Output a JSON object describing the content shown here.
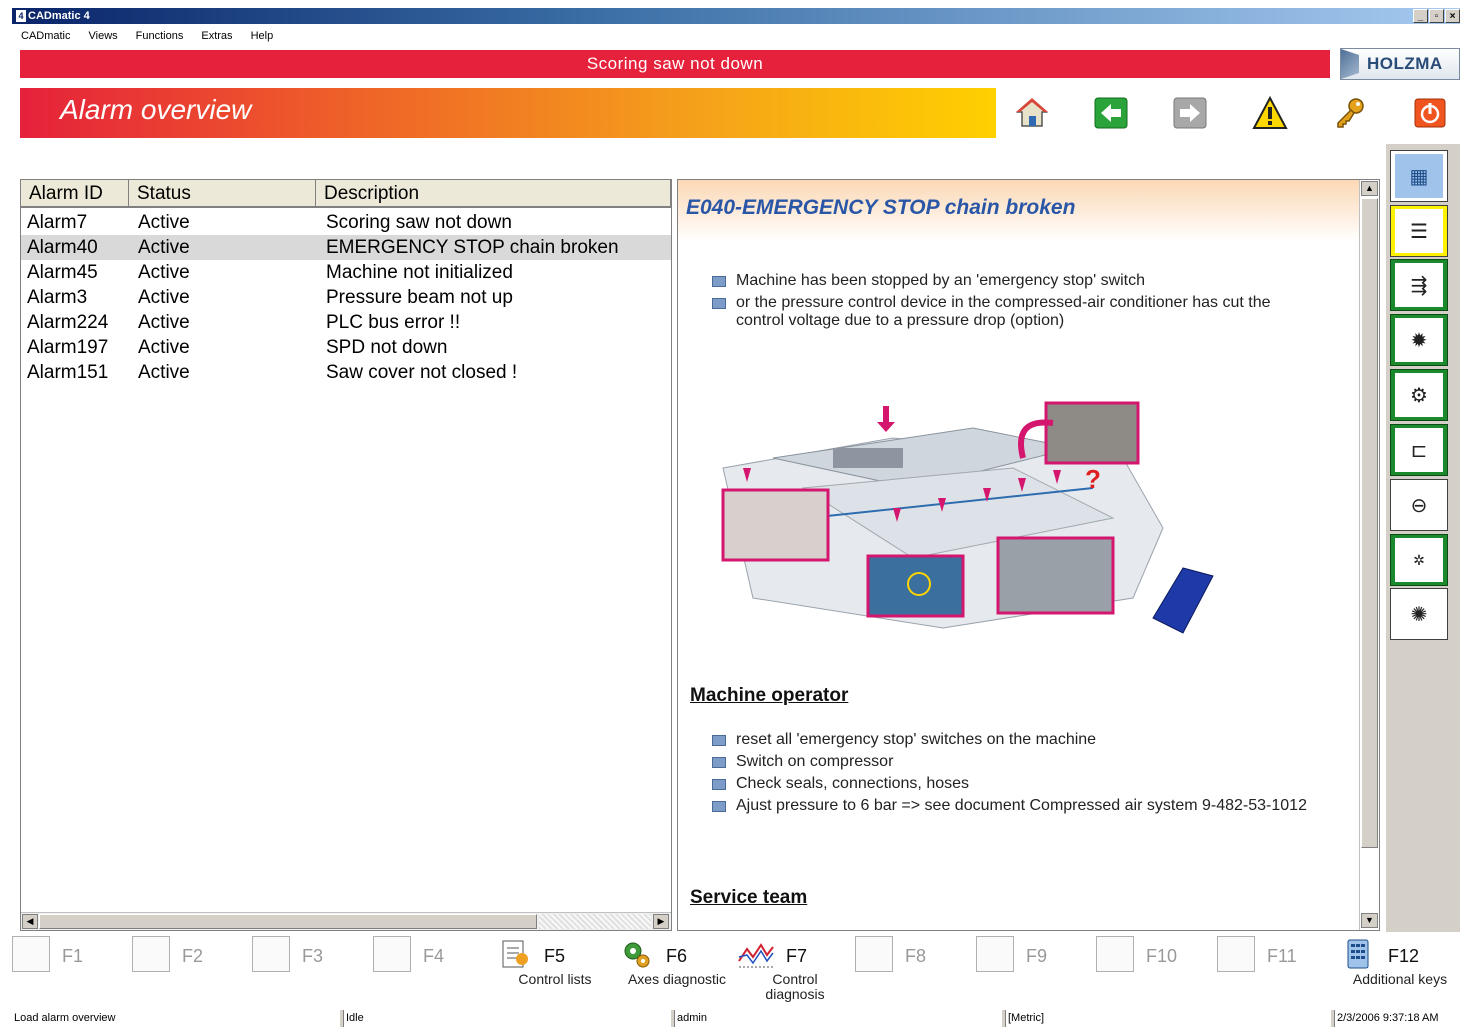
{
  "window": {
    "title": "CADmatic 4",
    "buttons": [
      "_",
      "▫",
      "×"
    ]
  },
  "menu": [
    "CADmatic",
    "Views",
    "Functions",
    "Extras",
    "Help"
  ],
  "message": "Scoring saw not down",
  "logo": "HOLZMA",
  "header": {
    "title": "Alarm overview"
  },
  "toolbar_icons": [
    "home-icon",
    "back-icon",
    "forward-icon",
    "warning-icon",
    "key-icon",
    "power-icon"
  ],
  "colors": {
    "alarm_red": "#e5213b",
    "banner_orange": "#f5a21a",
    "banner_yellow": "#ffd000",
    "title_blue": "#2a56a8",
    "sidebar_green": "#1b8a2c",
    "sidebar_yellow": "#fff200"
  },
  "alarm_table": {
    "columns": [
      "Alarm ID",
      "Status",
      "Description"
    ],
    "rows": [
      {
        "id": "Alarm7",
        "status": "Active",
        "description": "Scoring saw not down"
      },
      {
        "id": "Alarm40",
        "status": "Active",
        "description": "EMERGENCY STOP chain broken"
      },
      {
        "id": "Alarm45",
        "status": "Active",
        "description": "Machine not initialized"
      },
      {
        "id": "Alarm3",
        "status": "Active",
        "description": "Pressure beam not up"
      },
      {
        "id": "Alarm224",
        "status": "Active",
        "description": "PLC bus error !!"
      },
      {
        "id": "Alarm197",
        "status": "Active",
        "description": "SPD not down"
      },
      {
        "id": "Alarm151",
        "status": "Active",
        "description": "Saw cover not closed !"
      }
    ],
    "selected_index": 1
  },
  "detail": {
    "title": "E040-EMERGENCY STOP chain broken",
    "causes": [
      "Machine has been stopped by an 'emergency stop' switch",
      "or the pressure control device in the compressed-air conditioner has cut the control voltage due to a pressure drop (option)"
    ],
    "operator_heading": "Machine operator",
    "operator_steps": [
      "reset all 'emergency stop' switches on the machine",
      "Switch on compressor",
      "Check seals, connections, hoses",
      "Ajust pressure to 6 bar => see document Compressed air system 9-482-53-1012"
    ],
    "service_heading": "Service team"
  },
  "sidebar_icons": [
    "keypad-icon",
    "stack-icon",
    "feed-icon",
    "saw-icon",
    "saw-cut-icon",
    "pusher-icon",
    "lift-icon",
    "small-saw-icon",
    "saw-outline-icon"
  ],
  "function_keys": [
    {
      "key": "F1",
      "label": "",
      "enabled": false
    },
    {
      "key": "F2",
      "label": "",
      "enabled": false
    },
    {
      "key": "F3",
      "label": "",
      "enabled": false
    },
    {
      "key": "F4",
      "label": "",
      "enabled": false
    },
    {
      "key": "F5",
      "label": "Control lists",
      "enabled": true,
      "icon": "list-icon"
    },
    {
      "key": "F6",
      "label": "Axes diagnostic",
      "enabled": true,
      "icon": "gears-icon"
    },
    {
      "key": "F7",
      "label": "Control diagnosis",
      "enabled": true,
      "icon": "graph-icon"
    },
    {
      "key": "F8",
      "label": "",
      "enabled": false
    },
    {
      "key": "F9",
      "label": "",
      "enabled": false
    },
    {
      "key": "F10",
      "label": "",
      "enabled": false
    },
    {
      "key": "F11",
      "label": "",
      "enabled": false
    },
    {
      "key": "F12",
      "label": "Additional keys",
      "enabled": true,
      "icon": "keypad-icon"
    }
  ],
  "status_bar": {
    "message": "Load alarm overview",
    "state": "Idle",
    "user": "admin",
    "units": "[Metric]",
    "datetime": "2/3/2006 9:37:18 AM"
  }
}
